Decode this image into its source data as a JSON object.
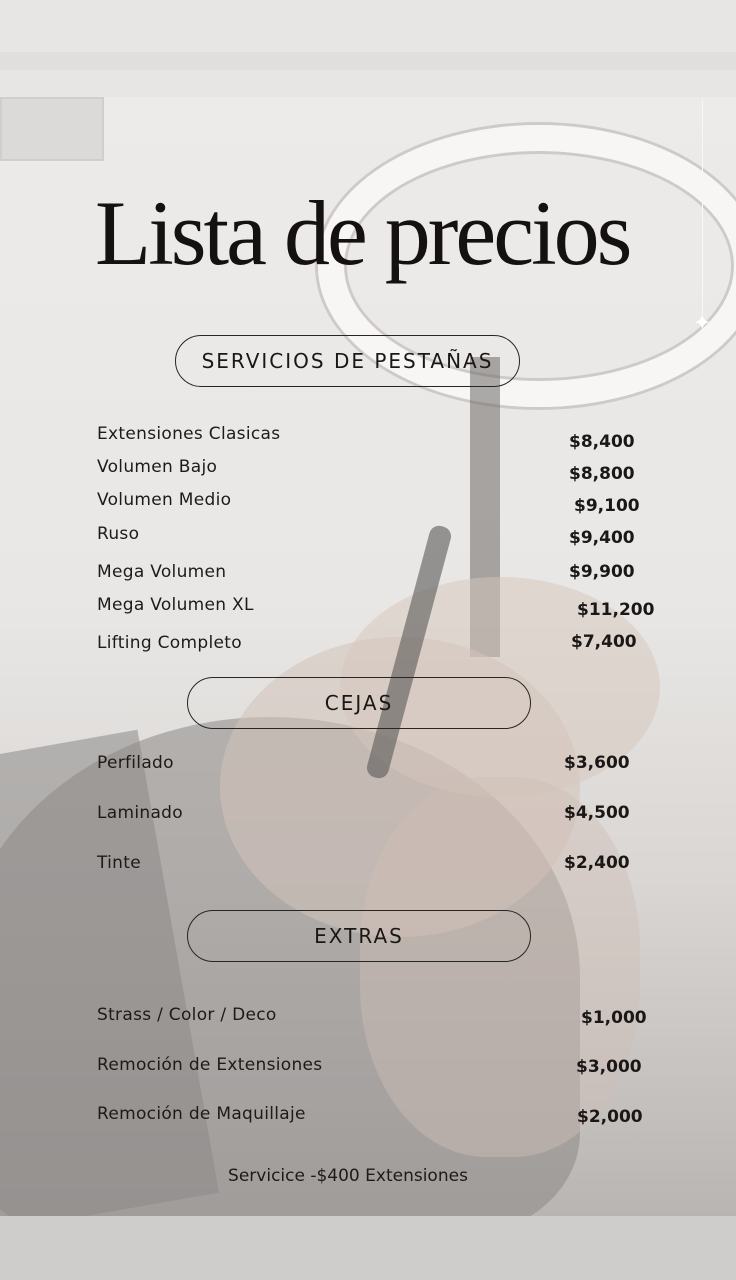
{
  "title": "Lista de precios",
  "sections": {
    "pestanas": {
      "heading": "SERVICIOS DE PESTAÑAS",
      "items": [
        {
          "name": "Extensiones Clasicas",
          "price": "$8,400"
        },
        {
          "name": "Volumen Bajo",
          "price": "$8,800"
        },
        {
          "name": "Volumen Medio",
          "price": "$9,100"
        },
        {
          "name": "Ruso",
          "price": "$9,400"
        },
        {
          "name": "Mega Volumen",
          "price": "$9,900"
        },
        {
          "name": "Mega Volumen XL",
          "price": "$11,200"
        },
        {
          "name": "Lifting Completo",
          "price": "$7,400"
        }
      ]
    },
    "cejas": {
      "heading": "CEJAS",
      "items": [
        {
          "name": "Perfilado",
          "price": "$3,600"
        },
        {
          "name": "Laminado",
          "price": "$4,500"
        },
        {
          "name": "Tinte",
          "price": "$2,400"
        }
      ]
    },
    "extras": {
      "heading": "EXTRAS",
      "items": [
        {
          "name": "Strass / Color / Deco",
          "price": "$1,000"
        },
        {
          "name": "Remoción de Extensiones",
          "price": "$3,000"
        },
        {
          "name": "Remoción de Maquillaje",
          "price": "$2,000"
        }
      ]
    }
  },
  "footer_note": "Servicice -$400 Extensiones",
  "colors": {
    "text": "#1a1716",
    "background": "#e6e3e1"
  },
  "icons": {
    "sparkle": "sparkle-icon"
  }
}
